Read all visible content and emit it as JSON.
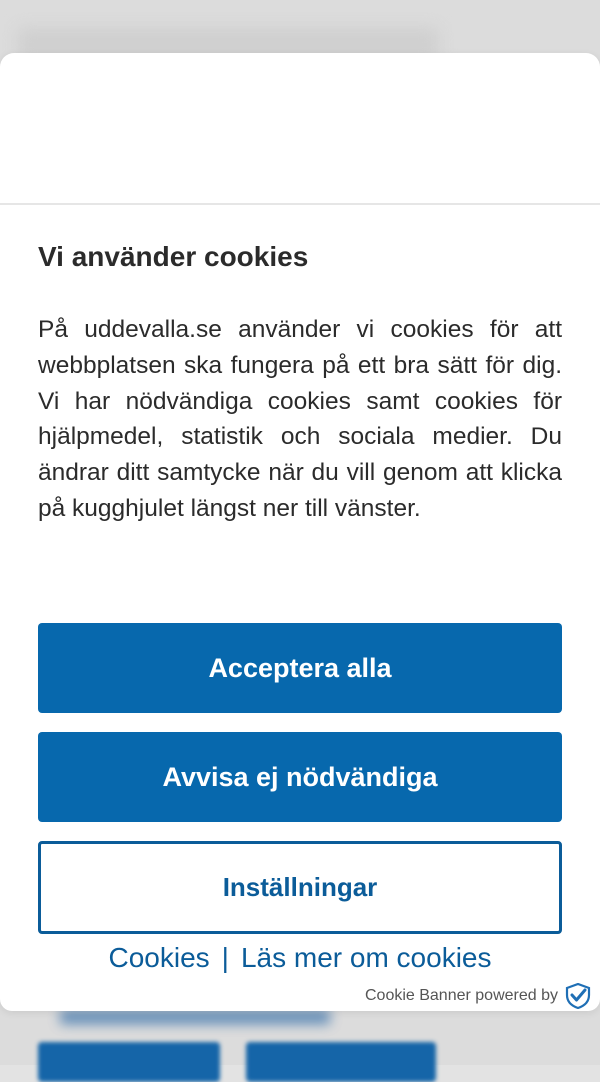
{
  "banner": {
    "title": "Vi använder cookies",
    "description": "På uddevalla.se använder vi cookies för att webbplatsen ska fungera på ett bra sätt för dig. Vi har nödvändiga cookies samt cookies för hjälpmedel, statistik och sociala medier. Du ändrar ditt samtycke när du vill genom att klicka på kugghjulet längst ner till vänster.",
    "accept_label": "Acceptera alla",
    "reject_label": "Avvisa ej nödvändiga",
    "settings_label": "Inställningar",
    "links": {
      "cookies": "Cookies",
      "separator": "|",
      "read_more": "Läs mer om cookies"
    },
    "powered_by": "Cookie Banner powered by",
    "powered_icon": "checkmark-shield-icon"
  },
  "colors": {
    "primary": "#0768ad",
    "outline": "#0b5c99",
    "text": "#2b2b2b"
  }
}
